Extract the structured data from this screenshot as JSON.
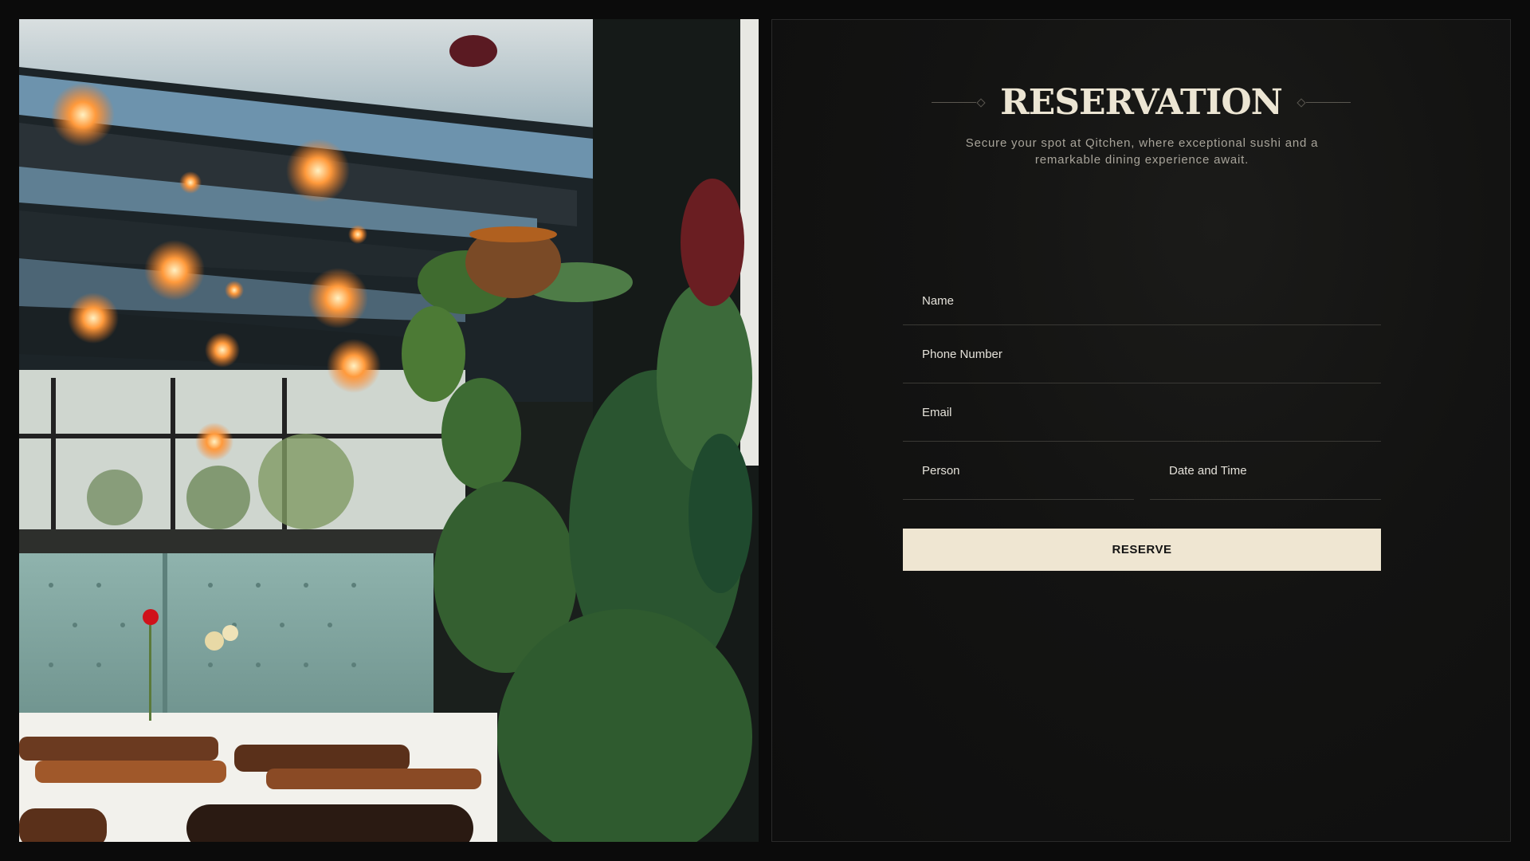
{
  "reservation": {
    "title": "RESERVATION",
    "subtitle": "Secure your spot at Qitchen, where exceptional sushi and a remarkable dining experience await."
  },
  "form": {
    "name_placeholder": "Name",
    "phone_placeholder": "Phone Number",
    "email_placeholder": "Email",
    "person_placeholder": "Person",
    "datetime_placeholder": "Date and Time",
    "submit_label": "RESERVE"
  },
  "colors": {
    "background": "#0b0b0b",
    "accent_button": "#efe6d2",
    "title": "#ece5d3"
  },
  "icons": [
    "ornament-diamond-icon"
  ]
}
